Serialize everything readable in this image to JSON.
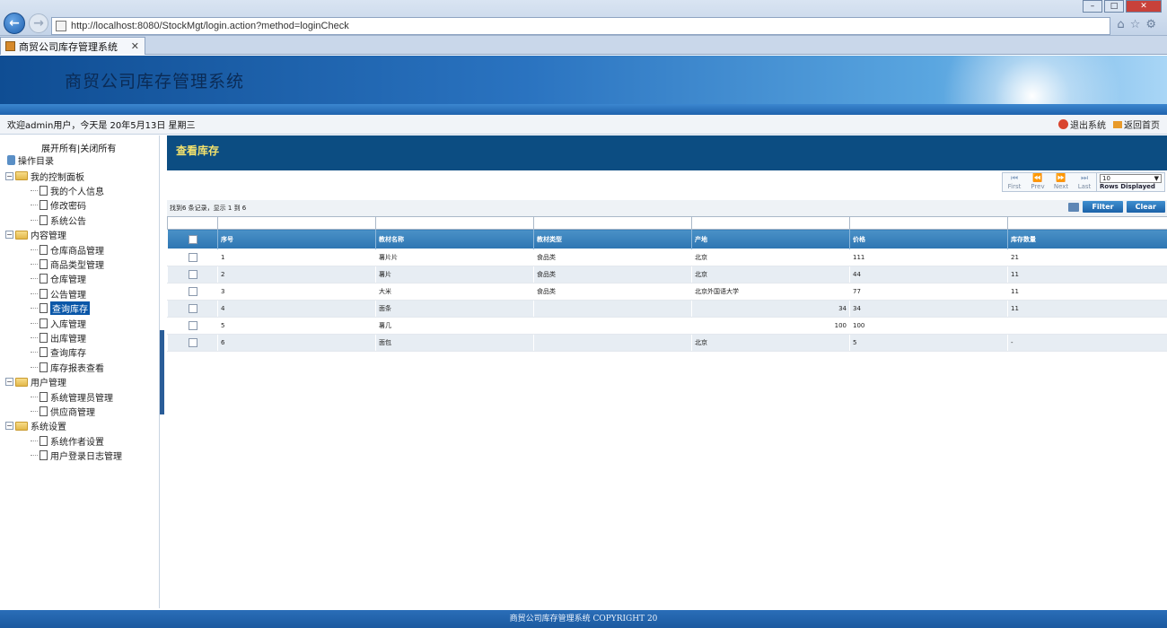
{
  "browser": {
    "url": "http://localhost:8080/StockMgt/login.action?method=loginCheck",
    "tab_title": "商贸公司库存管理系统",
    "tab_close": "✕"
  },
  "app": {
    "title": "商贸公司库存管理系统",
    "welcome": "欢迎admin用户，今天是 20年5月13日 星期三",
    "links": {
      "logout": "退出系统",
      "home": "返回首页"
    },
    "footer": "商贸公司库存管理系统 COPYRIGHT 20"
  },
  "sidebar": {
    "expand_all": "展开所有",
    "separator": "|",
    "collapse_all": "关闭所有",
    "root_label": "操作目录",
    "groups": [
      {
        "label": "我的控制面板",
        "items": [
          "我的个人信息",
          "修改密码",
          "系统公告"
        ]
      },
      {
        "label": "内容管理",
        "items": [
          "仓库商品管理",
          "商品类型管理",
          "仓库管理",
          "公告管理",
          "查询库存",
          "入库管理",
          "出库管理",
          "查询库存",
          "库存报表查看"
        ]
      },
      {
        "label": "用户管理",
        "items": [
          "系统管理员管理",
          "供应商管理"
        ]
      },
      {
        "label": "系统设置",
        "items": [
          "系统作者设置",
          "用户登录日志管理"
        ]
      }
    ],
    "selected_item": "查询库存"
  },
  "main": {
    "page_title": "查看库存",
    "pager": {
      "first": "First",
      "prev": "Prev",
      "next": "Next",
      "last": "Last",
      "rows_value": "10",
      "rows_label": "Rows Displayed"
    },
    "summary": "找到6 条记录，显示 1 到 6",
    "filter_button": "Filter",
    "clear_button": "Clear",
    "columns": [
      "序号",
      "教材名称",
      "教材类型",
      "产地",
      "价格",
      "库存数量"
    ],
    "rows": [
      {
        "no": "1",
        "name": "薯片片",
        "type": "食品类",
        "origin": "北京",
        "price_left": "",
        "price": "111",
        "qty": "21"
      },
      {
        "no": "2",
        "name": "薯片",
        "type": "食品类",
        "origin": "北京",
        "price_left": "",
        "price": "44",
        "qty": "11"
      },
      {
        "no": "3",
        "name": "大米",
        "type": "食品类",
        "origin": "北京外国语大学",
        "price_left": "",
        "price": "77",
        "qty": "11"
      },
      {
        "no": "4",
        "name": "面条",
        "type": "",
        "origin": "",
        "price_left": "34",
        "price": "34",
        "qty": "11"
      },
      {
        "no": "5",
        "name": "薯几",
        "type": "",
        "origin": "",
        "price_left": "100",
        "price": "100",
        "qty": ""
      },
      {
        "no": "6",
        "name": "面包",
        "type": "",
        "origin": "北京",
        "price_left": "",
        "price": "5",
        "qty": "-"
      }
    ]
  },
  "colors": {
    "header_blue": "#0c4d82",
    "title_yellow": "#f3e26c",
    "grid_header": "#2d75b2"
  }
}
